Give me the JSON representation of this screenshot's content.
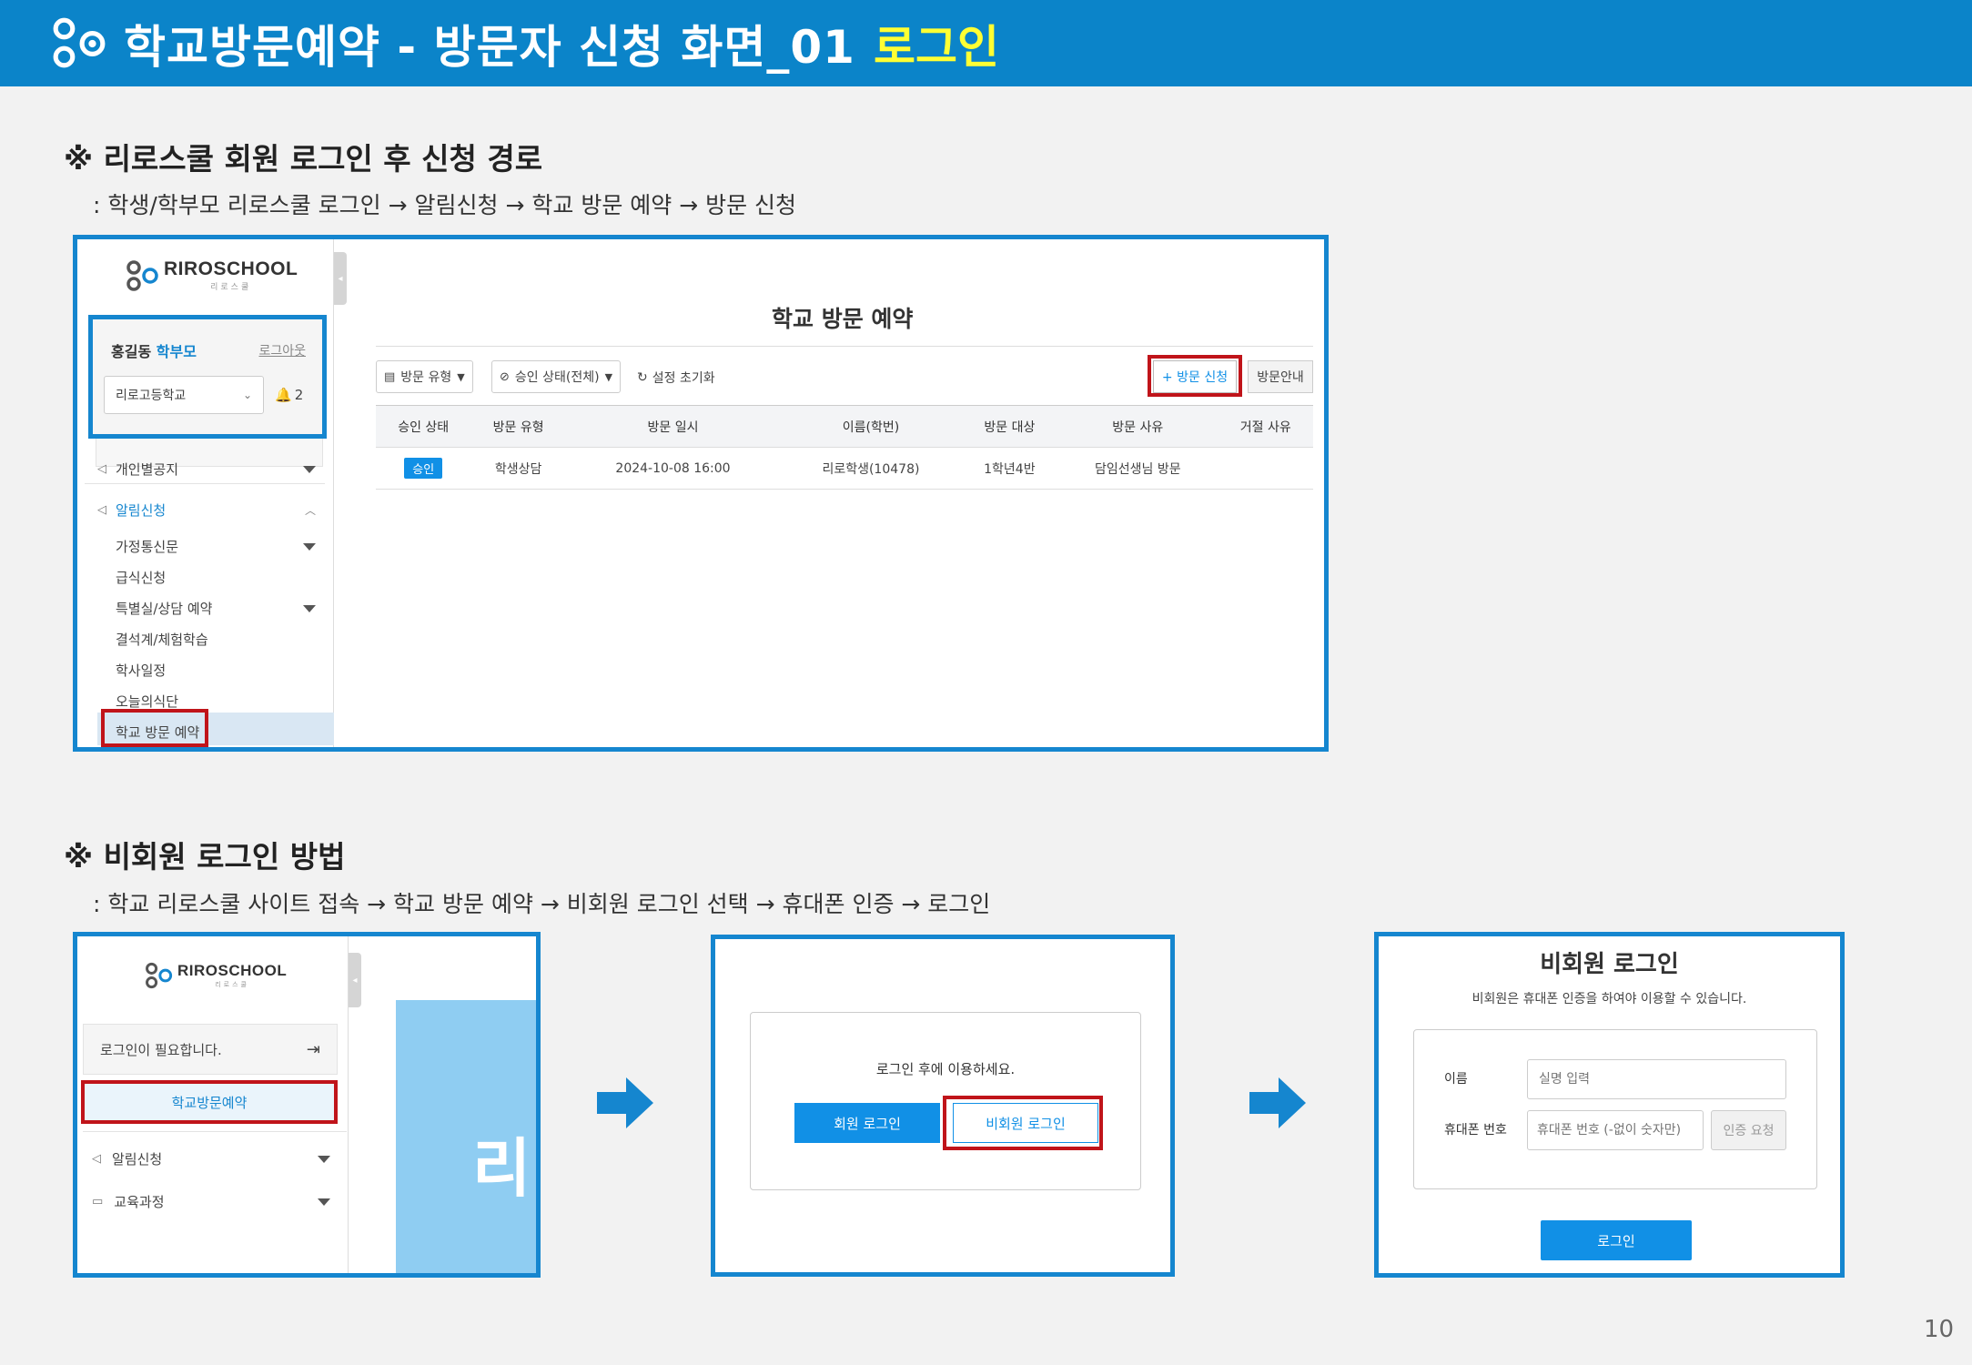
{
  "header": {
    "title": "학교방문예약 - 방문자 신청 화면_01",
    "highlight": "로그인",
    "logo_icon": "riroschool-logo-icon"
  },
  "section1": {
    "title": "※ 리로스쿨 회원 로그인 후 신청 경로",
    "path": ": 학생/학부모 리로스쿨 로그인 → 알림신청 → 학교 방문 예약 → 방문 신청"
  },
  "section2": {
    "title": "※ 비회원 로그인 방법",
    "path": ": 학교 리로스쿨 사이트 접속 → 학교 방문 예약 → 비회원 로그인 선택 → 휴대폰 인증 → 로그인"
  },
  "shot1": {
    "logo_text": "RIROSCHOOL",
    "logo_sub": "리로스쿨",
    "user_name": "홍길동",
    "user_role": "학부모",
    "logout": "로그아웃",
    "school": "리로고등학교",
    "bell_count": "2",
    "menu": {
      "personal": "개인별공지",
      "alert": "알림신청",
      "sub": [
        "가정통신문",
        "급식신청",
        "특별실/상담 예약",
        "결석계/체험학습",
        "학사일정",
        "오늘의식단",
        "학교 방문 예약"
      ]
    },
    "page_title": "학교 방문 예약",
    "filter_type": "방문 유형",
    "filter_status": "승인 상태(전체)",
    "reset": "설정 초기화",
    "apply_button": "+ 방문 신청",
    "guide_button": "방문안내",
    "columns": [
      "승인 상태",
      "방문 유형",
      "방문 일시",
      "이름(학번)",
      "방문 대상",
      "방문 사유",
      "거절 사유"
    ],
    "rows": [
      [
        "승인",
        "학생상담",
        "2024-10-08 16:00",
        "리로학생(10478)",
        "1학년4반",
        "담임선생님 방문",
        ""
      ]
    ]
  },
  "shot2": {
    "logo_text": "RIROSCHOOL",
    "logo_sub": "리로스쿨",
    "login_needed": "로그인이 필요합니다.",
    "visit_button": "학교방문예약",
    "menu": [
      "알림신청",
      "교육과정"
    ],
    "banner_char": "리"
  },
  "shot3": {
    "message": "로그인 후에 이용하세요.",
    "member_login": "회원 로그인",
    "guest_login": "비회원 로그인"
  },
  "shot4": {
    "title": "비회원 로그인",
    "subtitle": "비회원은 휴대폰 인증을 하여야 이용할 수 있습니다.",
    "name_label": "이름",
    "name_placeholder": "실명 입력",
    "phone_label": "휴대폰 번호",
    "phone_placeholder": "휴대폰 번호 (-없이 숫자만)",
    "verify_button": "인증 요청",
    "login_button": "로그인"
  },
  "page_number": "10",
  "colors": {
    "header_bg": "#0b84c9",
    "highlight": "#ffff33",
    "frame": "#1586cf",
    "marker": "#c0141a",
    "primary": "#1190e6"
  }
}
